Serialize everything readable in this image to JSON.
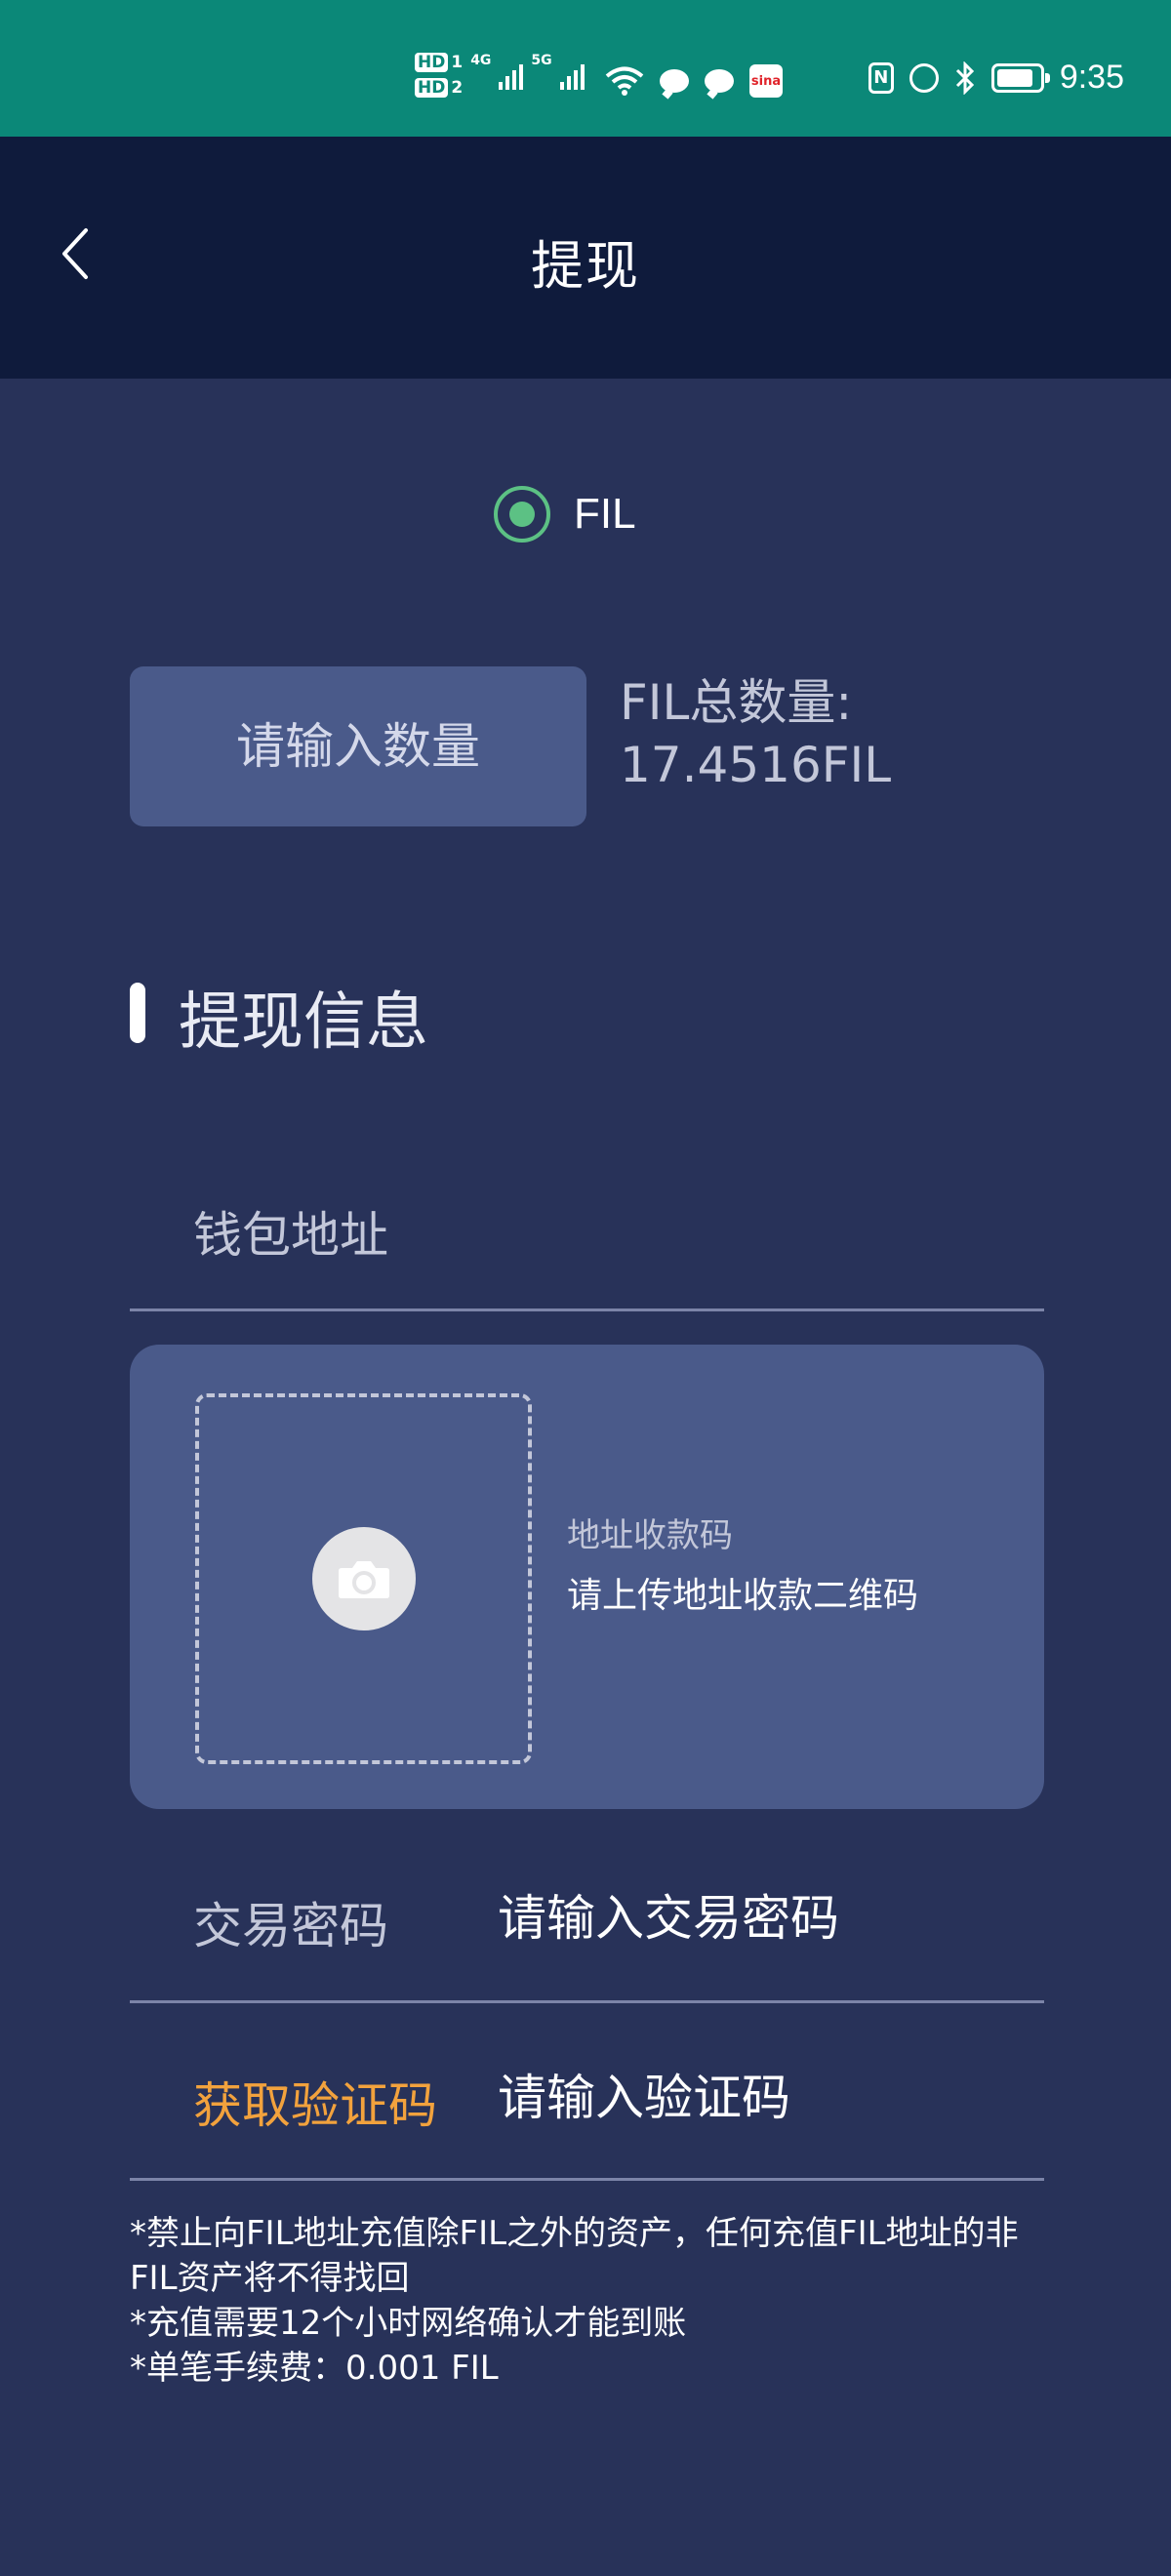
{
  "status_bar": {
    "hd1": "HD",
    "hd1_num": "1",
    "hd2": "HD",
    "hd2_num": "2",
    "net1": "4G",
    "net2": "5G",
    "sina": "sina",
    "nfc": "N",
    "battery_level": 0.85,
    "time": "9:35"
  },
  "header": {
    "title": "提现"
  },
  "currency": {
    "selected": "FIL"
  },
  "amount": {
    "placeholder": "请输入数量",
    "total_label": "FIL总数量:",
    "total_value": "17.4516FIL"
  },
  "section": {
    "title": "提现信息"
  },
  "wallet": {
    "label": "钱包地址"
  },
  "qr": {
    "title": "地址收款码",
    "subtitle": "请上传地址收款二维码"
  },
  "password": {
    "label": "交易密码",
    "placeholder": "请输入交易密码"
  },
  "code": {
    "button": "获取验证码",
    "placeholder": "请输入验证码"
  },
  "notes": [
    "*禁止向FIL地址充值除FIL之外的资产，任何充值FIL地址的非",
    "FIL资产将不得找回",
    "*充值需要12个小时网络确认才能到账",
    "*单笔手续费：0.001 FIL"
  ],
  "colors": {
    "status_bar": "#0b8878",
    "header": "#0f1b3c",
    "background": "#283259",
    "card": "#4a5a8a",
    "radio": "#5cc184",
    "accent": "#f2a23d"
  }
}
